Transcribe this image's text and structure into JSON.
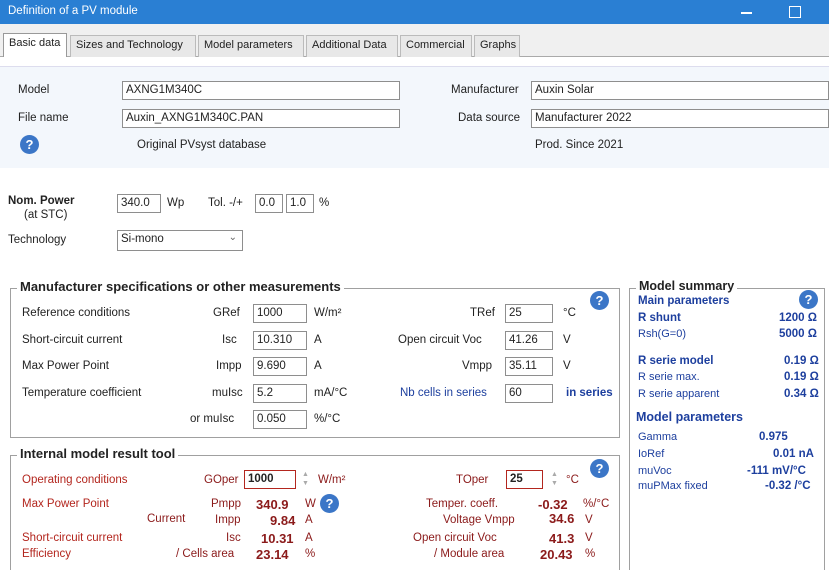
{
  "window": {
    "title": "Definition of a PV module"
  },
  "tabs": [
    "Basic data",
    "Sizes and Technology",
    "Model parameters",
    "Additional Data",
    "Commercial",
    "Graphs"
  ],
  "basic": {
    "model_label": "Model",
    "model_value": "AXNG1M340C",
    "filename_label": "File name",
    "filename_value": "Auxin_AXNG1M340C.PAN",
    "manufacturer_label": "Manufacturer",
    "manufacturer_value": "Auxin Solar",
    "datasource_label": "Data source",
    "datasource_value": "Manufacturer 2022",
    "db_text": "Original PVsyst database",
    "prod_text": "Prod. Since 2021"
  },
  "power": {
    "nom_label": "Nom. Power",
    "stc_label": "(at STC)",
    "nom_value": "340.0",
    "nom_unit": "Wp",
    "tol_label": "Tol. -/+",
    "tol_minus": "0.0",
    "tol_plus": "1.0",
    "tol_unit": "%",
    "tech_label": "Technology",
    "tech_value": "Si-mono"
  },
  "mfr": {
    "title": "Manufacturer specifications or other measurements",
    "ref_label": "Reference conditions",
    "gref_label": "GRef",
    "gref_value": "1000",
    "gref_unit": "W/m²",
    "tref_label": "TRef",
    "tref_value": "25",
    "tref_unit": "°C",
    "sc_label": "Short-circuit current",
    "isc_label": "Isc",
    "isc_value": "10.310",
    "isc_unit": "A",
    "voc_label": "Open circuit Voc",
    "voc_value": "41.26",
    "voc_unit": "V",
    "mpp_label": "Max Power Point",
    "impp_label": "Impp",
    "impp_value": "9.690",
    "impp_unit": "A",
    "vmpp_label": "Vmpp",
    "vmpp_value": "35.11",
    "vmpp_unit": "V",
    "tc_label": "Temperature coefficient",
    "muisc_label": "muIsc",
    "muisc_value": "5.2",
    "muisc_unit": "mA/°C",
    "cells_label": "Nb cells in series",
    "cells_value": "60",
    "cells_unit": "in series",
    "or_muisc_label": "or muIsc",
    "muisc_pct_value": "0.050",
    "muisc_pct_unit": "%/°C"
  },
  "tool": {
    "title": "Internal model result tool",
    "op_label": "Operating conditions",
    "goper_label": "GOper",
    "goper_value": "1000",
    "goper_unit": "W/m²",
    "toper_label": "TOper",
    "toper_value": "25",
    "toper_unit": "°C",
    "mpp_label": "Max Power Point",
    "pmpp_label": "Pmpp",
    "pmpp_value": "340.9",
    "pmpp_unit": "W",
    "tcoef_label": "Temper. coeff.",
    "tcoef_value": "-0.32",
    "tcoef_unit": "%/°C",
    "current_label": "Current",
    "impp_label": "Impp",
    "impp_value": "9.84",
    "impp_unit": "A",
    "vmpp_label": "Voltage Vmpp",
    "vmpp_value": "34.6",
    "vmpp_unit": "V",
    "sc_label": "Short-circuit current",
    "isc_label": "Isc",
    "isc_value": "10.31",
    "isc_unit": "A",
    "voc_label": "Open circuit Voc",
    "voc_value": "41.3",
    "voc_unit": "V",
    "eff_label": "Efficiency",
    "cells_area_label": "/ Cells area",
    "cells_area_value": "23.14",
    "cells_area_unit": "%",
    "module_area_label": "/ Module area",
    "module_area_value": "20.43",
    "module_area_unit": "%"
  },
  "summary": {
    "title": "Model summary",
    "main_label": "Main parameters",
    "rshunt_label": "R shunt",
    "rshunt_value": "1200 Ω",
    "rshg_label": "Rsh(G=0)",
    "rshg_value": "5000 Ω",
    "rserie_label": "R serie model",
    "rserie_value": "0.19 Ω",
    "rseriemax_label": "R serie max.",
    "rseriemax_value": "0.19 Ω",
    "rserieapp_label": "R serie apparent",
    "rserieapp_value": "0.34 Ω",
    "modelparams_label": "Model parameters",
    "gamma_label": "Gamma",
    "gamma_value": "0.975",
    "ioref_label": "IoRef",
    "ioref_value": "0.01 nA",
    "muvoc_label": "muVoc",
    "muvoc_value": "-111 mV/°C",
    "mupmax_label": "muPMax fixed",
    "mupmax_value": "-0.32 /°C"
  },
  "colors": {
    "titlebar": "#2a7fd3",
    "help": "#3b76c7",
    "red_label": "#b3261e",
    "blue_label": "#1d3f9e"
  }
}
